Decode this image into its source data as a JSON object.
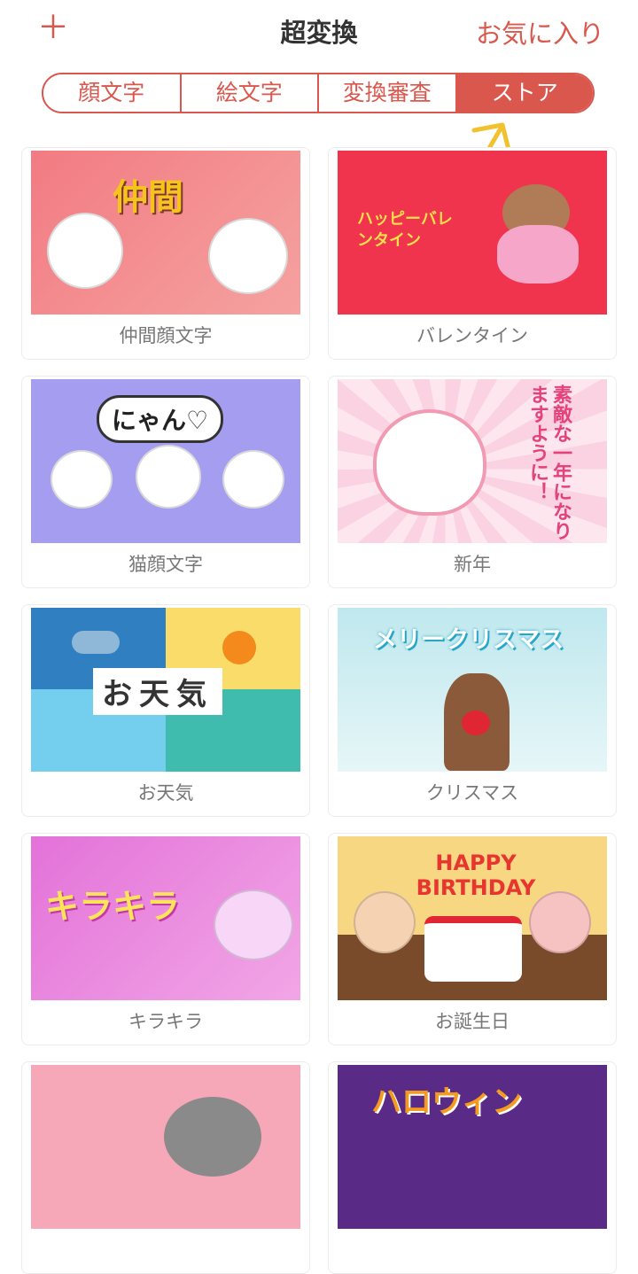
{
  "header": {
    "plus_label": "＋",
    "title": "超変換",
    "favorites_label": "お気に入り"
  },
  "tabs": [
    {
      "label": "顔文字",
      "active": false
    },
    {
      "label": "絵文字",
      "active": false
    },
    {
      "label": "変換審査",
      "active": false
    },
    {
      "label": "ストア",
      "active": true
    }
  ],
  "accent_color": "#d9574d",
  "store_items": [
    {
      "label": "仲間顔文字",
      "banner_text": "仲間"
    },
    {
      "label": "バレンタイン",
      "banner_text": "ハッピーバレンタイン"
    },
    {
      "label": "猫顔文字",
      "banner_text": "にゃん♡"
    },
    {
      "label": "新年",
      "banner_text": "素敵な一年になりますように！"
    },
    {
      "label": "お天気",
      "banner_text": "お天気"
    },
    {
      "label": "クリスマス",
      "banner_text": "メリークリスマス"
    },
    {
      "label": "キラキラ",
      "banner_text": "キラキラ"
    },
    {
      "label": "お誕生日",
      "banner_text": "HAPPY BIRTHDAY"
    },
    {
      "label": "",
      "banner_text": ""
    },
    {
      "label": "",
      "banner_text": "ハロウィン"
    }
  ]
}
